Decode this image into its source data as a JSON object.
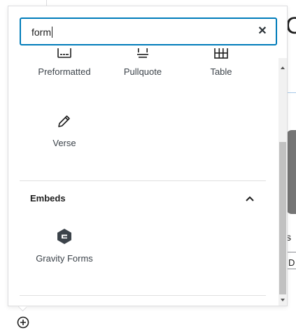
{
  "search": {
    "value": "form"
  },
  "blocks_top": [
    {
      "label": "Preformatted",
      "icon": "preformatted-icon"
    },
    {
      "label": "Pullquote",
      "icon": "pullquote-icon"
    },
    {
      "label": "Table",
      "icon": "table-icon"
    }
  ],
  "blocks_text": [
    {
      "label": "Verse",
      "icon": "pencil-icon"
    }
  ],
  "embeds": {
    "title": "Embeds",
    "items": [
      {
        "label": "Gravity Forms",
        "icon": "gravity-forms-icon"
      }
    ]
  },
  "background": {
    "heading_glyph": "C",
    "text_s": "s",
    "text_d": "D"
  },
  "colors": {
    "accent": "#007cba",
    "icon": "#1e1e1e",
    "gravity_forms": "#3c434a"
  }
}
